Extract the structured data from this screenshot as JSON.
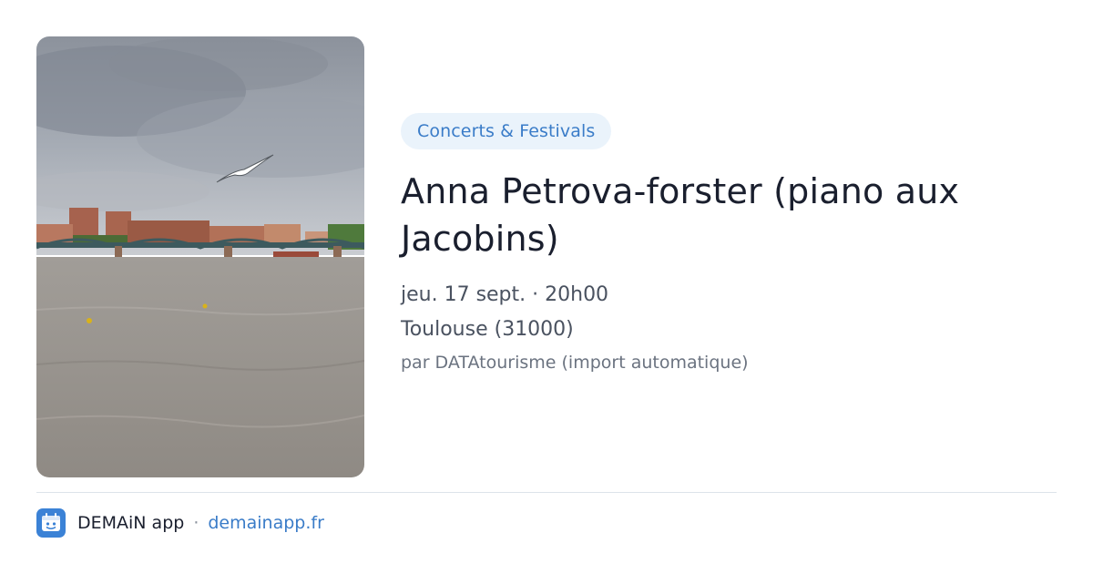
{
  "event": {
    "category": "Concerts & Festivals",
    "title": "Anna Petrova-forster (piano aux Jacobins)",
    "date": "jeu. 17 sept. · 20h00",
    "location": "Toulouse (31000)",
    "source": "par DATAtourisme (import automatique)"
  },
  "footer": {
    "app_name": "DEMAiN app",
    "separator": "·",
    "link": "demainapp.fr"
  },
  "colors": {
    "accent": "#3a7cc8",
    "badge_bg": "#eaf3fb",
    "divider": "#dde4ea",
    "app_icon": "#3b82d6"
  }
}
